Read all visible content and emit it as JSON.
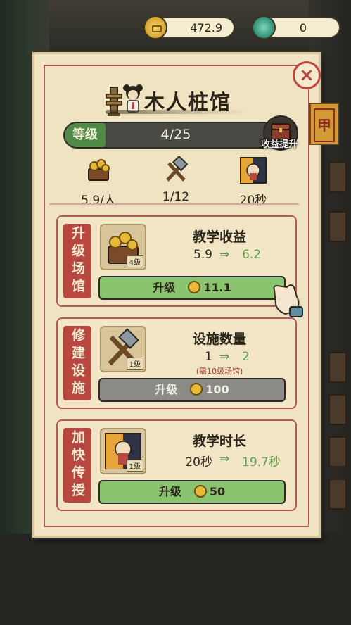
{
  "currency": {
    "coins": "472.9",
    "jade": "0"
  },
  "panel": {
    "title": "木人桩馆",
    "close_label": "×",
    "side_tab": "甲",
    "level_label": "等级",
    "level_value": "4/25",
    "boost_label": "收益提升"
  },
  "stats": [
    {
      "value": "5.9/人",
      "icon": "coin-chest-icon"
    },
    {
      "value": "1/12",
      "icon": "hammer-icon"
    },
    {
      "value": "20秒",
      "icon": "day-night-icon"
    }
  ],
  "cards": [
    {
      "tab": "升级场馆",
      "thumb_level": "4级",
      "title": "教学收益",
      "from": "5.9",
      "to": "6.2",
      "note": "",
      "button_label": "升级",
      "cost": "11.1",
      "enabled": true
    },
    {
      "tab": "修建设施",
      "thumb_level": "1级",
      "title": "设施数量",
      "from": "1",
      "to": "2",
      "note": "(需10级场馆)",
      "button_label": "升级",
      "cost": "100",
      "enabled": false
    },
    {
      "tab": "加快传授",
      "thumb_level": "1级",
      "title": "教学时长",
      "from": "20秒",
      "to": "19.7秒",
      "note": "",
      "button_label": "升级",
      "cost": "50",
      "enabled": true
    }
  ],
  "colors": {
    "accent_red": "#b8473f",
    "button_green": "#8bc46e",
    "button_grey": "#8c8a84",
    "parchment": "#efe3c2"
  }
}
